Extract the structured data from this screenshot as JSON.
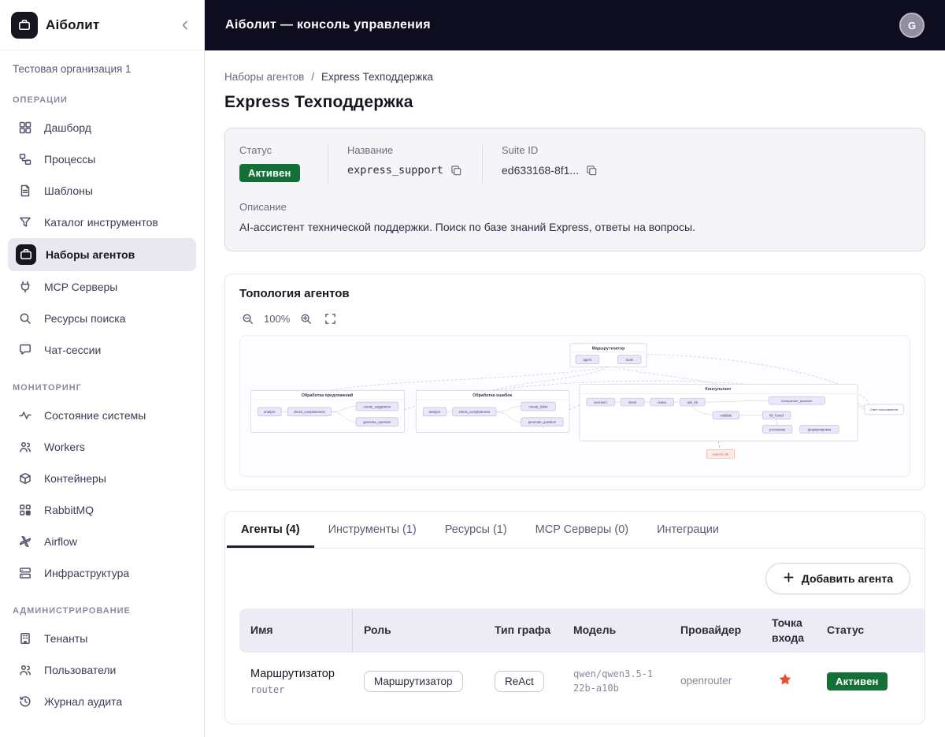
{
  "app": {
    "name": "Аіболит",
    "header_title": "Аіболит — консоль управления",
    "avatar_letter": "G",
    "org": "Тестовая организация 1"
  },
  "sidebar": {
    "sections": [
      {
        "label": "ОПЕРАЦИИ",
        "items": [
          {
            "label": "Дашборд",
            "icon": "dashboard",
            "active": false
          },
          {
            "label": "Процессы",
            "icon": "processes",
            "active": false
          },
          {
            "label": "Шаблоны",
            "icon": "templates",
            "active": false
          },
          {
            "label": "Каталог инструментов",
            "icon": "tools-catalog",
            "active": false
          },
          {
            "label": "Наборы агентов",
            "icon": "agent-suites",
            "active": true
          },
          {
            "label": "MCP Серверы",
            "icon": "mcp-servers",
            "active": false
          },
          {
            "label": "Ресурсы поиска",
            "icon": "search-resources",
            "active": false
          },
          {
            "label": "Чат-сессии",
            "icon": "chat-sessions",
            "active": false
          }
        ]
      },
      {
        "label": "МОНИТОРИНГ",
        "items": [
          {
            "label": "Состояние системы",
            "icon": "system-health",
            "active": false
          },
          {
            "label": "Workers",
            "icon": "workers",
            "active": false
          },
          {
            "label": "Контейнеры",
            "icon": "containers",
            "active": false
          },
          {
            "label": "RabbitMQ",
            "icon": "rabbitmq",
            "active": false
          },
          {
            "label": "Airflow",
            "icon": "airflow",
            "active": false
          },
          {
            "label": "Инфраструктура",
            "icon": "infrastructure",
            "active": false
          }
        ]
      },
      {
        "label": "АДМИНИСТРИРОВАНИЕ",
        "items": [
          {
            "label": "Тенанты",
            "icon": "tenants",
            "active": false
          },
          {
            "label": "Пользователи",
            "icon": "users",
            "active": false
          },
          {
            "label": "Журнал аудита",
            "icon": "audit-log",
            "active": false
          }
        ]
      }
    ]
  },
  "breadcrumb": {
    "parent": "Наборы агентов",
    "separator": "/",
    "current": "Express Техподдержка"
  },
  "page": {
    "title": "Express Техподдержка"
  },
  "info_card": {
    "status_label": "Статус",
    "status_value": "Активен",
    "name_label": "Название",
    "name_value": "express_support",
    "suite_id_label": "Suite ID",
    "suite_id_value": "ed633168-8f1...",
    "description_label": "Описание",
    "description_value": "AI-ассистент технической поддержки. Поиск по базе знаний Express, ответы на вопросы."
  },
  "topology": {
    "title": "Топология агентов",
    "zoom_level": "100%",
    "router": {
      "title": "Маршрутизатор",
      "nodes": [
        "agent",
        "tools"
      ]
    },
    "groups": [
      {
        "title": "Обработка предложений",
        "nodes": [
          "analyze",
          "check_completeness",
          "create_suggestion",
          "generate_question"
        ]
      },
      {
        "title": "Обработка ошибок",
        "nodes": [
          "analyze",
          "check_completeness",
          "create_ticket",
          "generate_question"
        ]
      },
      {
        "title": "Консультант",
        "nodes": [
          "контекст",
          "intent",
          "поиск",
          "ask_kb",
          "validate",
          "kb_found",
          "уточнение",
          "формулировка"
        ],
        "decision": "Консультант_решение"
      }
    ],
    "output_node": "Ответ пользователю",
    "kb_node": "express_kb"
  },
  "tabs": [
    {
      "key": "agents",
      "label": "Агенты (4)",
      "active": true
    },
    {
      "key": "tools",
      "label": "Инструменты (1)",
      "active": false
    },
    {
      "key": "resources",
      "label": "Ресурсы (1)",
      "active": false
    },
    {
      "key": "mcp-servers",
      "label": "MCP Серверы (0)",
      "active": false
    },
    {
      "key": "integrations",
      "label": "Интеграции",
      "active": false
    }
  ],
  "agents": {
    "add_button_label": "Добавить агента",
    "columns": [
      "Имя",
      "Роль",
      "Тип графа",
      "Модель",
      "Провайдер",
      "Точка входа",
      "Статус",
      ""
    ],
    "rows": [
      {
        "name": "Маршрутизатор",
        "slug": "router",
        "role": "Маршрутизатор",
        "graph_type": "ReAct",
        "model": "qwen/qwen3.5-122b-a10b",
        "provider": "openrouter",
        "entry_point": true,
        "status": "Активен"
      }
    ]
  },
  "colors": {
    "header_bg": "#0d0d1f",
    "status_green": "#157038",
    "entry_star": "#e8512e",
    "active_item_bg": "#e9e7f0"
  }
}
